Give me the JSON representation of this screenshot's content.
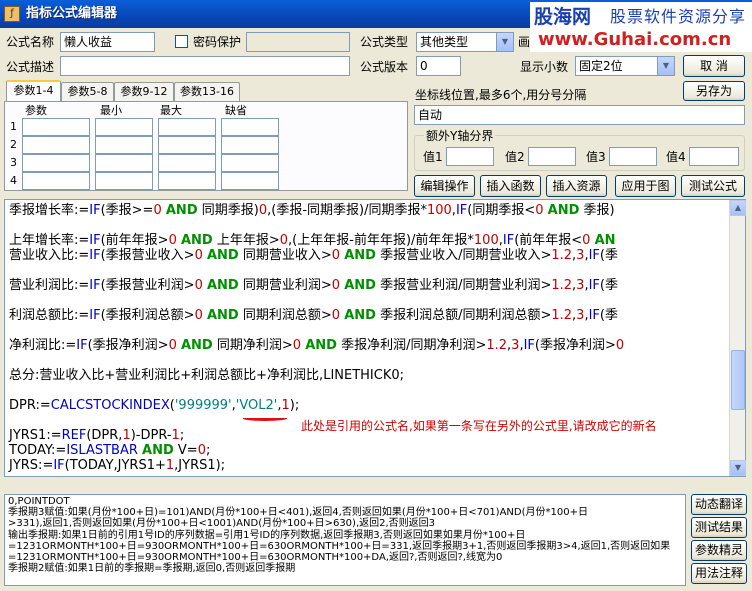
{
  "window": {
    "title": "指标公式编辑器"
  },
  "brand": {
    "part1": "股海网",
    "part2": "股票软件资源分享",
    "url": "www.Guhai.com.cn"
  },
  "form": {
    "name_label": "公式名称",
    "name_value": "懒人收益",
    "password_label": "密码保护",
    "type_label": "公式类型",
    "type_value": "其他类型",
    "desc_label": "公式描述",
    "version_label": "公式版本",
    "version_value": "0",
    "decimal_label": "显示小数",
    "decimal_value": "固定2位",
    "cut_char": "画"
  },
  "buttons": {
    "cancel": "取  消",
    "save_as": "另存为",
    "edit_op": "编辑操作",
    "insert_func": "插入函数",
    "insert_res": "插入资源",
    "apply_chart": "应用于图",
    "test": "测试公式",
    "dyn_translate": "动态翻译",
    "test_result": "测试结果",
    "param_wizard": "参数精灵",
    "usage_note": "用法注释"
  },
  "tabs": [
    "参数1-4",
    "参数5-8",
    "参数9-12",
    "参数13-16"
  ],
  "params": {
    "headers": [
      "参数",
      "最小",
      "最大",
      "缺省"
    ],
    "rows": [
      "1",
      "2",
      "3",
      "4"
    ]
  },
  "axis": {
    "label": "坐标线位置,最多6个,用分号分隔",
    "value": "自动",
    "group_label": "额外Y轴分界",
    "value_labels": [
      "值1",
      "值2",
      "值3",
      "值4"
    ]
  },
  "code": {
    "l1": {
      "a": "季报增长率:=",
      "b": "IF",
      "c": "(季报>=",
      "d": "0",
      "e": "AND",
      "f": "同期季报)",
      "g": "0",
      "h": ",(季报-同期季报)/同期季报*",
      "i": "100",
      "j": ",",
      "k": "IF",
      "l": "(同期季报<",
      "m": "0",
      "n": "AND",
      "o": "季报)"
    },
    "l2": {
      "a": "上年增长率:=",
      "b": "IF",
      "c": "(前年年报>",
      "d": "0",
      "e": "AND",
      "f": "上年年报>",
      "g": "0",
      "h": ",(上年年报-前年年报)/前年年报*",
      "i": "100",
      "j": ",",
      "k": "IF",
      "l": "(前年年报<",
      "m": "0",
      "n": "AN"
    },
    "l3": {
      "a": "营业收入比:=",
      "b": "IF",
      "c": "(季报营业收入>",
      "d": "0",
      "e": "AND",
      "f": "同期营业收入>",
      "g": "0",
      "h": "AND",
      "i": "季报营业收入/同期营业收入>",
      "j": "1.2",
      "k": ",",
      "l": "3",
      "m": ",",
      "n": "IF",
      "o": "(季"
    },
    "l4": {
      "a": "营业利润比:=",
      "b": "IF",
      "c": "(季报营业利润>",
      "d": "0",
      "e": "AND",
      "f": "同期营业利润>",
      "g": "0",
      "h": "AND",
      "i": "季报营业利润/同期营业利润>",
      "j": "1.2",
      "k": ",",
      "l": "3",
      "m": ",",
      "n": "IF",
      "o": "(季"
    },
    "l5": {
      "a": "利润总额比:=",
      "b": "IF",
      "c": "(季报利润总额>",
      "d": "0",
      "e": "AND",
      "f": "同期利润总额>",
      "g": "0",
      "h": "AND",
      "i": "季报利润总额/同期利润总额>",
      "j": "1.2",
      "k": ",",
      "l": "3",
      "m": ",",
      "n": "IF",
      "o": "(季"
    },
    "l6": {
      "a": "净利润比:=",
      "b": "IF",
      "c": "(季报净利润>",
      "d": "0",
      "e": "AND",
      "f": "同期净利润>",
      "g": "0",
      "h": "AND",
      "i": "季报净利润/同期净利润>",
      "j": "1.2",
      "k": ",",
      "l": "3",
      "m": ",",
      "n": "IF",
      "o": "(季报净利润>",
      "p": "0"
    },
    "l7": {
      "a": "总分:营业收入比+营业利润比+利润总额比+净利润比,",
      "b": "LINETHICK0",
      "c": ";"
    },
    "l8": {
      "a": "DPR:=",
      "b": "CALCSTOCKINDEX",
      "c": "(",
      "d": "'999999'",
      "e": ",",
      "f": "'VOL2'",
      "g": ",",
      "h": "1",
      "i": ");"
    },
    "note": "此处是引用的公式名,如果第一条写在另外的公式里,请改成它的新名",
    "l9": {
      "a": "JYRS1:=",
      "b": "REF",
      "c": "(DPR,",
      "d": "1",
      "e": ")-DPR-",
      "f": "1",
      "g": ";"
    },
    "l10": {
      "a": "TODAY:=",
      "b": "ISLASTBAR",
      "c": "AND",
      "d": "V=",
      "e": "0",
      "f": ";"
    },
    "l11": {
      "a": "JYRS:=",
      "b": "IF",
      "c": "(TODAY,JYRS1+",
      "d": "1",
      "e": ",JYRS1);"
    }
  },
  "output": [
    "0,POINTDOT",
    "季报期3赋值:如果(月份*100+日)=101)AND(月份*100+日<401),返回4,否则返回如果(月份*100+日<701)AND(月份*100+日",
    ">331),返回1,否则返回如果(月份*100+日<1001)AND(月份*100+日>630),返回2,否则返回3",
    "输出季报期:如果1日前的引用1号ID的序列数据=引用1号ID的序列数据,返回季报期3,否则返回如果如果月份*100+日",
    "=1231ORMONTH*100+日=930ORMONTH*100+日=630ORMONTH*100+日=331,返回季报期3+1,否则返回季报期3>4,返回1,否则返回如果",
    "=1231ORMONTH*100+日=930ORMONTH*100+日=630ORMONTH*100+DA,返回?,否则返回?,线宽为0",
    "季报期2赋值:如果1日前的季报期=季报期,返回0,否则返回季报期"
  ],
  "colors": {
    "function": "#0000c0",
    "keyword": "#009000",
    "number": "#c00000",
    "string": "#008080",
    "annotation": "#d00000"
  }
}
